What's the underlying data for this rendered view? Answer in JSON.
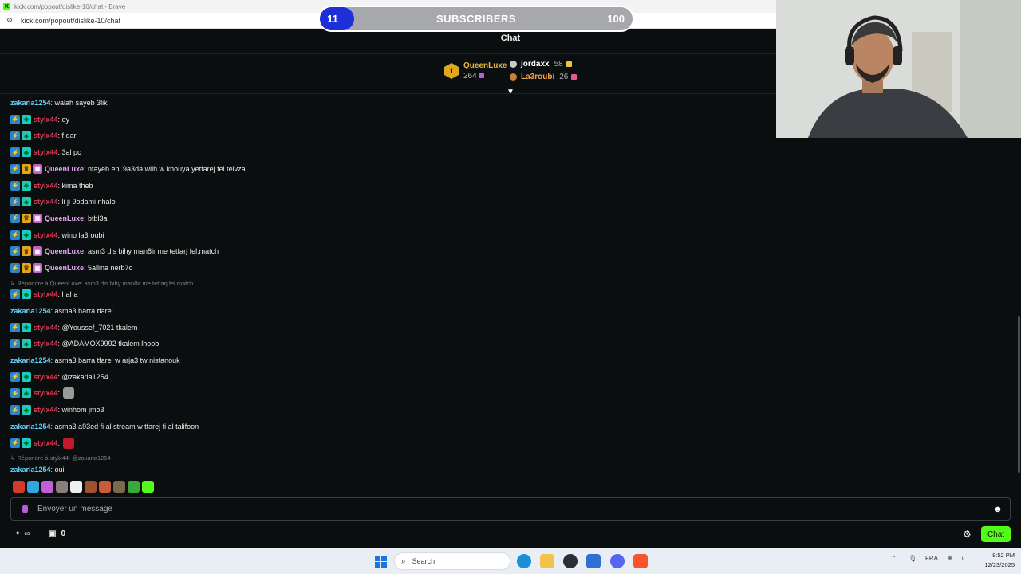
{
  "browser": {
    "title": "kick.com/popout/dislike-10/chat - Brave",
    "url": "kick.com/popout/dislike-10/chat"
  },
  "sub_goal": {
    "current": "11",
    "label": "SUBSCRIBERS",
    "target": "100",
    "progress_fraction": 0.11,
    "color_fill": "#1e2fd8"
  },
  "chat_header": {
    "title": "Chat"
  },
  "leaderboard": {
    "first": {
      "rank": "1",
      "name": "QueenLuxe",
      "value": "264"
    },
    "others": [
      {
        "name": "jordaxx",
        "value": "58",
        "color": "#ffffff",
        "dot": "#c9c9c9"
      },
      {
        "name": "La3roubi",
        "value": "26",
        "color": "#f2a44a",
        "dot": "#c97f3a"
      }
    ]
  },
  "messages": [
    {
      "type": "msg",
      "user": "zakaria1254",
      "color": "#64d2ff",
      "badges": [],
      "text": ": walah sayeb 3lik"
    },
    {
      "type": "msg",
      "user": "stylx44",
      "color": "#e53953",
      "badges": [
        "vip",
        "sub"
      ],
      "text": ": ey"
    },
    {
      "type": "msg",
      "user": "stylx44",
      "color": "#e53953",
      "badges": [
        "vip",
        "sub"
      ],
      "text": ": f dar"
    },
    {
      "type": "msg",
      "user": "stylx44",
      "color": "#e53953",
      "badges": [
        "vip",
        "sub"
      ],
      "text": ": 3al pc"
    },
    {
      "type": "msg",
      "user": "QueenLuxe",
      "color": "#e7a7f4",
      "badges": [
        "vip",
        "crown",
        "gift"
      ],
      "text": ": ntayeb eni 9a3da wilh w khouya yetfarej fel telvza"
    },
    {
      "type": "msg",
      "user": "stylx44",
      "color": "#e53953",
      "badges": [
        "vip",
        "sub"
      ],
      "text": ": kima theb"
    },
    {
      "type": "msg",
      "user": "stylx44",
      "color": "#e53953",
      "badges": [
        "vip",
        "sub"
      ],
      "text": ": li ji 9odami nhalo"
    },
    {
      "type": "msg",
      "user": "QueenLuxe",
      "color": "#e7a7f4",
      "badges": [
        "vip",
        "crown",
        "gift"
      ],
      "text": ": btbl3a"
    },
    {
      "type": "msg",
      "user": "stylx44",
      "color": "#e53953",
      "badges": [
        "vip",
        "sub"
      ],
      "text": ": wino la3roubi"
    },
    {
      "type": "msg",
      "user": "QueenLuxe",
      "color": "#e7a7f4",
      "badges": [
        "vip",
        "crown",
        "gift"
      ],
      "text": ": asm3 dis bihy man8ir me tetfarj fel.match"
    },
    {
      "type": "msg",
      "user": "QueenLuxe",
      "color": "#e7a7f4",
      "badges": [
        "vip",
        "crown",
        "gift"
      ],
      "text": ": 5allina nerb7o"
    },
    {
      "type": "reply",
      "text": "↳ Répondre à QueenLuxe: asm3 dis bihy man8ir me tetfarj fel.match"
    },
    {
      "type": "msg",
      "user": "stylx44",
      "color": "#e53953",
      "badges": [
        "vip",
        "sub"
      ],
      "text": ": haha"
    },
    {
      "type": "msg",
      "user": "zakaria1254",
      "color": "#64d2ff",
      "badges": [],
      "text": ": asma3 barra tfarel"
    },
    {
      "type": "msg",
      "user": "stylx44",
      "color": "#e53953",
      "badges": [
        "vip",
        "sub"
      ],
      "text": ": @Youssef_7021 tkalem"
    },
    {
      "type": "msg",
      "user": "stylx44",
      "color": "#e53953",
      "badges": [
        "vip",
        "sub"
      ],
      "text": ": @ADAMOX9992 tkalem lhoob"
    },
    {
      "type": "msg",
      "user": "zakaria1254",
      "color": "#64d2ff",
      "badges": [],
      "text": ": asma3 barra tfarej w arja3 tw nistanouk"
    },
    {
      "type": "msg",
      "user": "stylx44",
      "color": "#e53953",
      "badges": [
        "vip",
        "sub"
      ],
      "text": ": @zakaria1254"
    },
    {
      "type": "msg",
      "user": "stylx44",
      "color": "#e53953",
      "badges": [
        "vip",
        "sub"
      ],
      "text": ":",
      "emote": "#9a9a9a"
    },
    {
      "type": "msg",
      "user": "stylx44",
      "color": "#e53953",
      "badges": [
        "vip",
        "sub"
      ],
      "text": ": winhom jmo3"
    },
    {
      "type": "msg",
      "user": "zakaria1254",
      "color": "#64d2ff",
      "badges": [],
      "text": ": asma3 a93ed fi al stream w tfarej fi al talifoon"
    },
    {
      "type": "msg",
      "user": "stylx44",
      "color": "#e53953",
      "badges": [
        "vip",
        "sub"
      ],
      "text": ":",
      "emote": "#c0182d"
    },
    {
      "type": "reply",
      "text": "↳ Répondre à stylx44: @zakaria1254"
    },
    {
      "type": "msg",
      "user": "zakaria1254",
      "color": "#64d2ff",
      "badges": [],
      "text": ": oui"
    }
  ],
  "emote_bar": [
    "#d33a2c",
    "#2fa6e0",
    "#c25fd8",
    "#8a7e7a",
    "#f0f0f0",
    "#a0522d",
    "#c75b3a",
    "#7a6a4f",
    "#3aa83a",
    "#53fc18"
  ],
  "input": {
    "placeholder": "Envoyer un message",
    "value": ""
  },
  "bottom_bar": {
    "gift_count": "0",
    "chat_button": "Chat",
    "accent": "#53fc18"
  },
  "taskbar": {
    "search_label": "Search",
    "language": "FRA",
    "time": "8:52 PM",
    "date": "12/23/2025"
  }
}
